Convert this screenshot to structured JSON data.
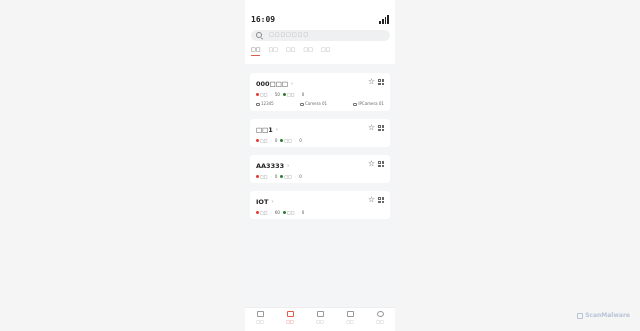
{
  "status_bar": {
    "time": "16:09"
  },
  "search": {
    "placeholder": "□□□□□□□"
  },
  "tabs": [
    "□□",
    "□□",
    "□□",
    "□□",
    "□□"
  ],
  "cards": [
    {
      "name": "000□□□",
      "offline_label": "□□",
      "offline": "50",
      "online_label": "□□",
      "online": "0",
      "devices": [
        {
          "label": "12345"
        },
        {
          "label": "Camera 01"
        },
        {
          "label": "IPCamera 01"
        }
      ]
    },
    {
      "name": "□□1",
      "offline_label": "□□",
      "offline": "0",
      "online_label": "□□",
      "online": "0",
      "devices": []
    },
    {
      "name": "AA3333",
      "offline_label": "□□",
      "offline": "0",
      "online_label": "□□",
      "online": "0",
      "devices": []
    },
    {
      "name": "IOT",
      "offline_label": "□□",
      "offline": "60",
      "online_label": "□□",
      "online": "0",
      "devices": []
    }
  ],
  "bottom_nav": [
    "□□",
    "□□",
    "□□",
    "□□",
    "□□"
  ],
  "watermark": "ScanMalware",
  "colors": {
    "accent": "#e05a4e",
    "offline": "#e53935",
    "online": "#2e7d32"
  }
}
